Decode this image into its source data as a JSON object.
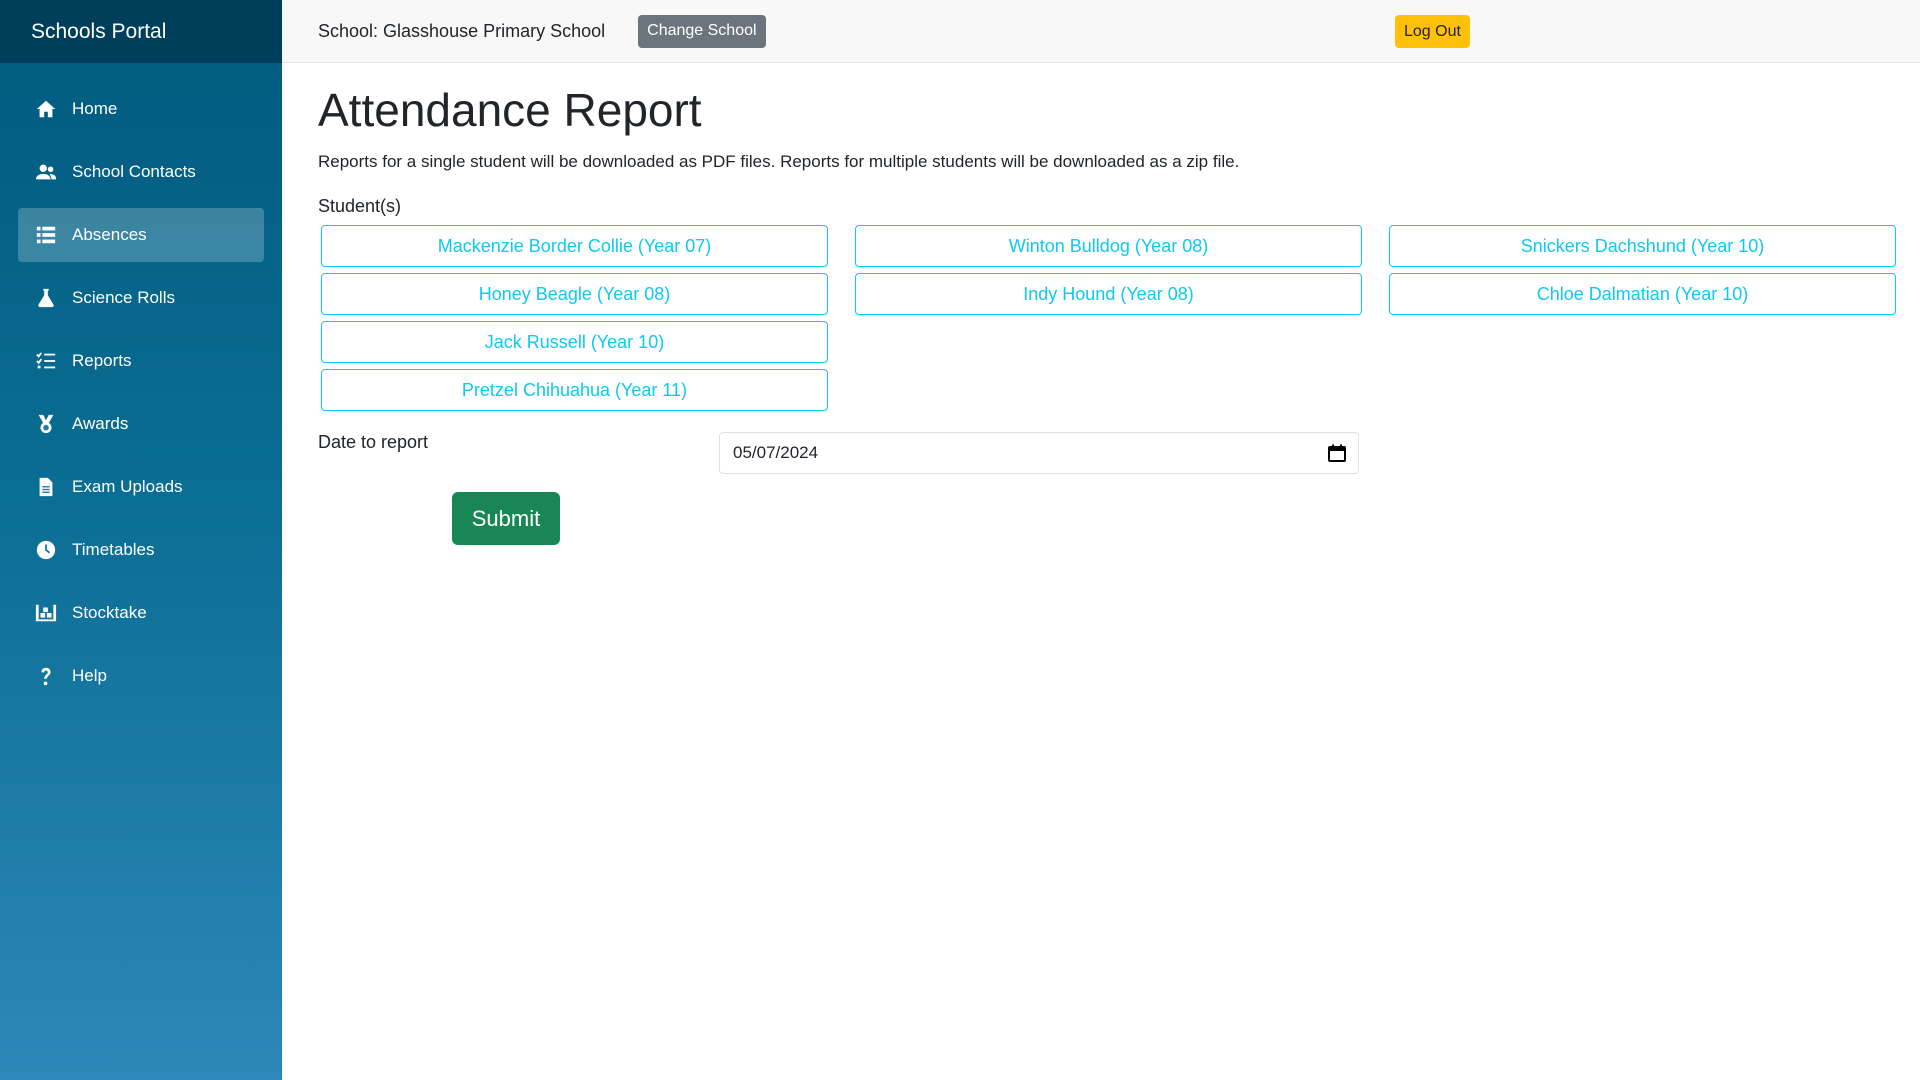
{
  "brand": "Schools Portal",
  "sidebar": {
    "items": [
      {
        "label": "Home",
        "icon": "home-icon",
        "active": false
      },
      {
        "label": "School Contacts",
        "icon": "contacts-icon",
        "active": false
      },
      {
        "label": "Absences",
        "icon": "list-icon",
        "active": true
      },
      {
        "label": "Science Rolls",
        "icon": "flask-icon",
        "active": false
      },
      {
        "label": "Reports",
        "icon": "checklist-icon",
        "active": false
      },
      {
        "label": "Awards",
        "icon": "medal-icon",
        "active": false
      },
      {
        "label": "Exam Uploads",
        "icon": "document-icon",
        "active": false
      },
      {
        "label": "Timetables",
        "icon": "clock-icon",
        "active": false
      },
      {
        "label": "Stocktake",
        "icon": "warehouse-icon",
        "active": false
      },
      {
        "label": "Help",
        "icon": "question-icon",
        "active": false
      }
    ]
  },
  "topbar": {
    "school_text": "School: Glasshouse Primary School",
    "change_school_label": "Change School",
    "logout_label": "Log Out"
  },
  "main": {
    "title": "Attendance Report",
    "description": "Reports for a single student will be downloaded as PDF files. Reports for multiple students will be downloaded as a zip file.",
    "students_label": "Student(s)",
    "students": [
      [
        "Mackenzie Border Collie (Year 07)",
        "Honey Beagle (Year 08)",
        "Jack Russell (Year 10)",
        "Pretzel Chihuahua (Year 11)"
      ],
      [
        "Winton Bulldog (Year 08)",
        "Indy Hound (Year 08)"
      ],
      [
        "Snickers Dachshund (Year 10)",
        "Chloe Dalmatian (Year 10)"
      ]
    ],
    "date_label": "Date to report",
    "date_value": "05/07/2024",
    "submit_label": "Submit"
  },
  "colors": {
    "sidebar_top": "#005a7d",
    "sidebar_bottom": "#2b88b8",
    "brand_bar": "#003f5c",
    "student_outline": "#0dcaf0",
    "submit_green": "#198754",
    "logout_yellow": "#ffc107",
    "change_grey": "#6c757d"
  }
}
